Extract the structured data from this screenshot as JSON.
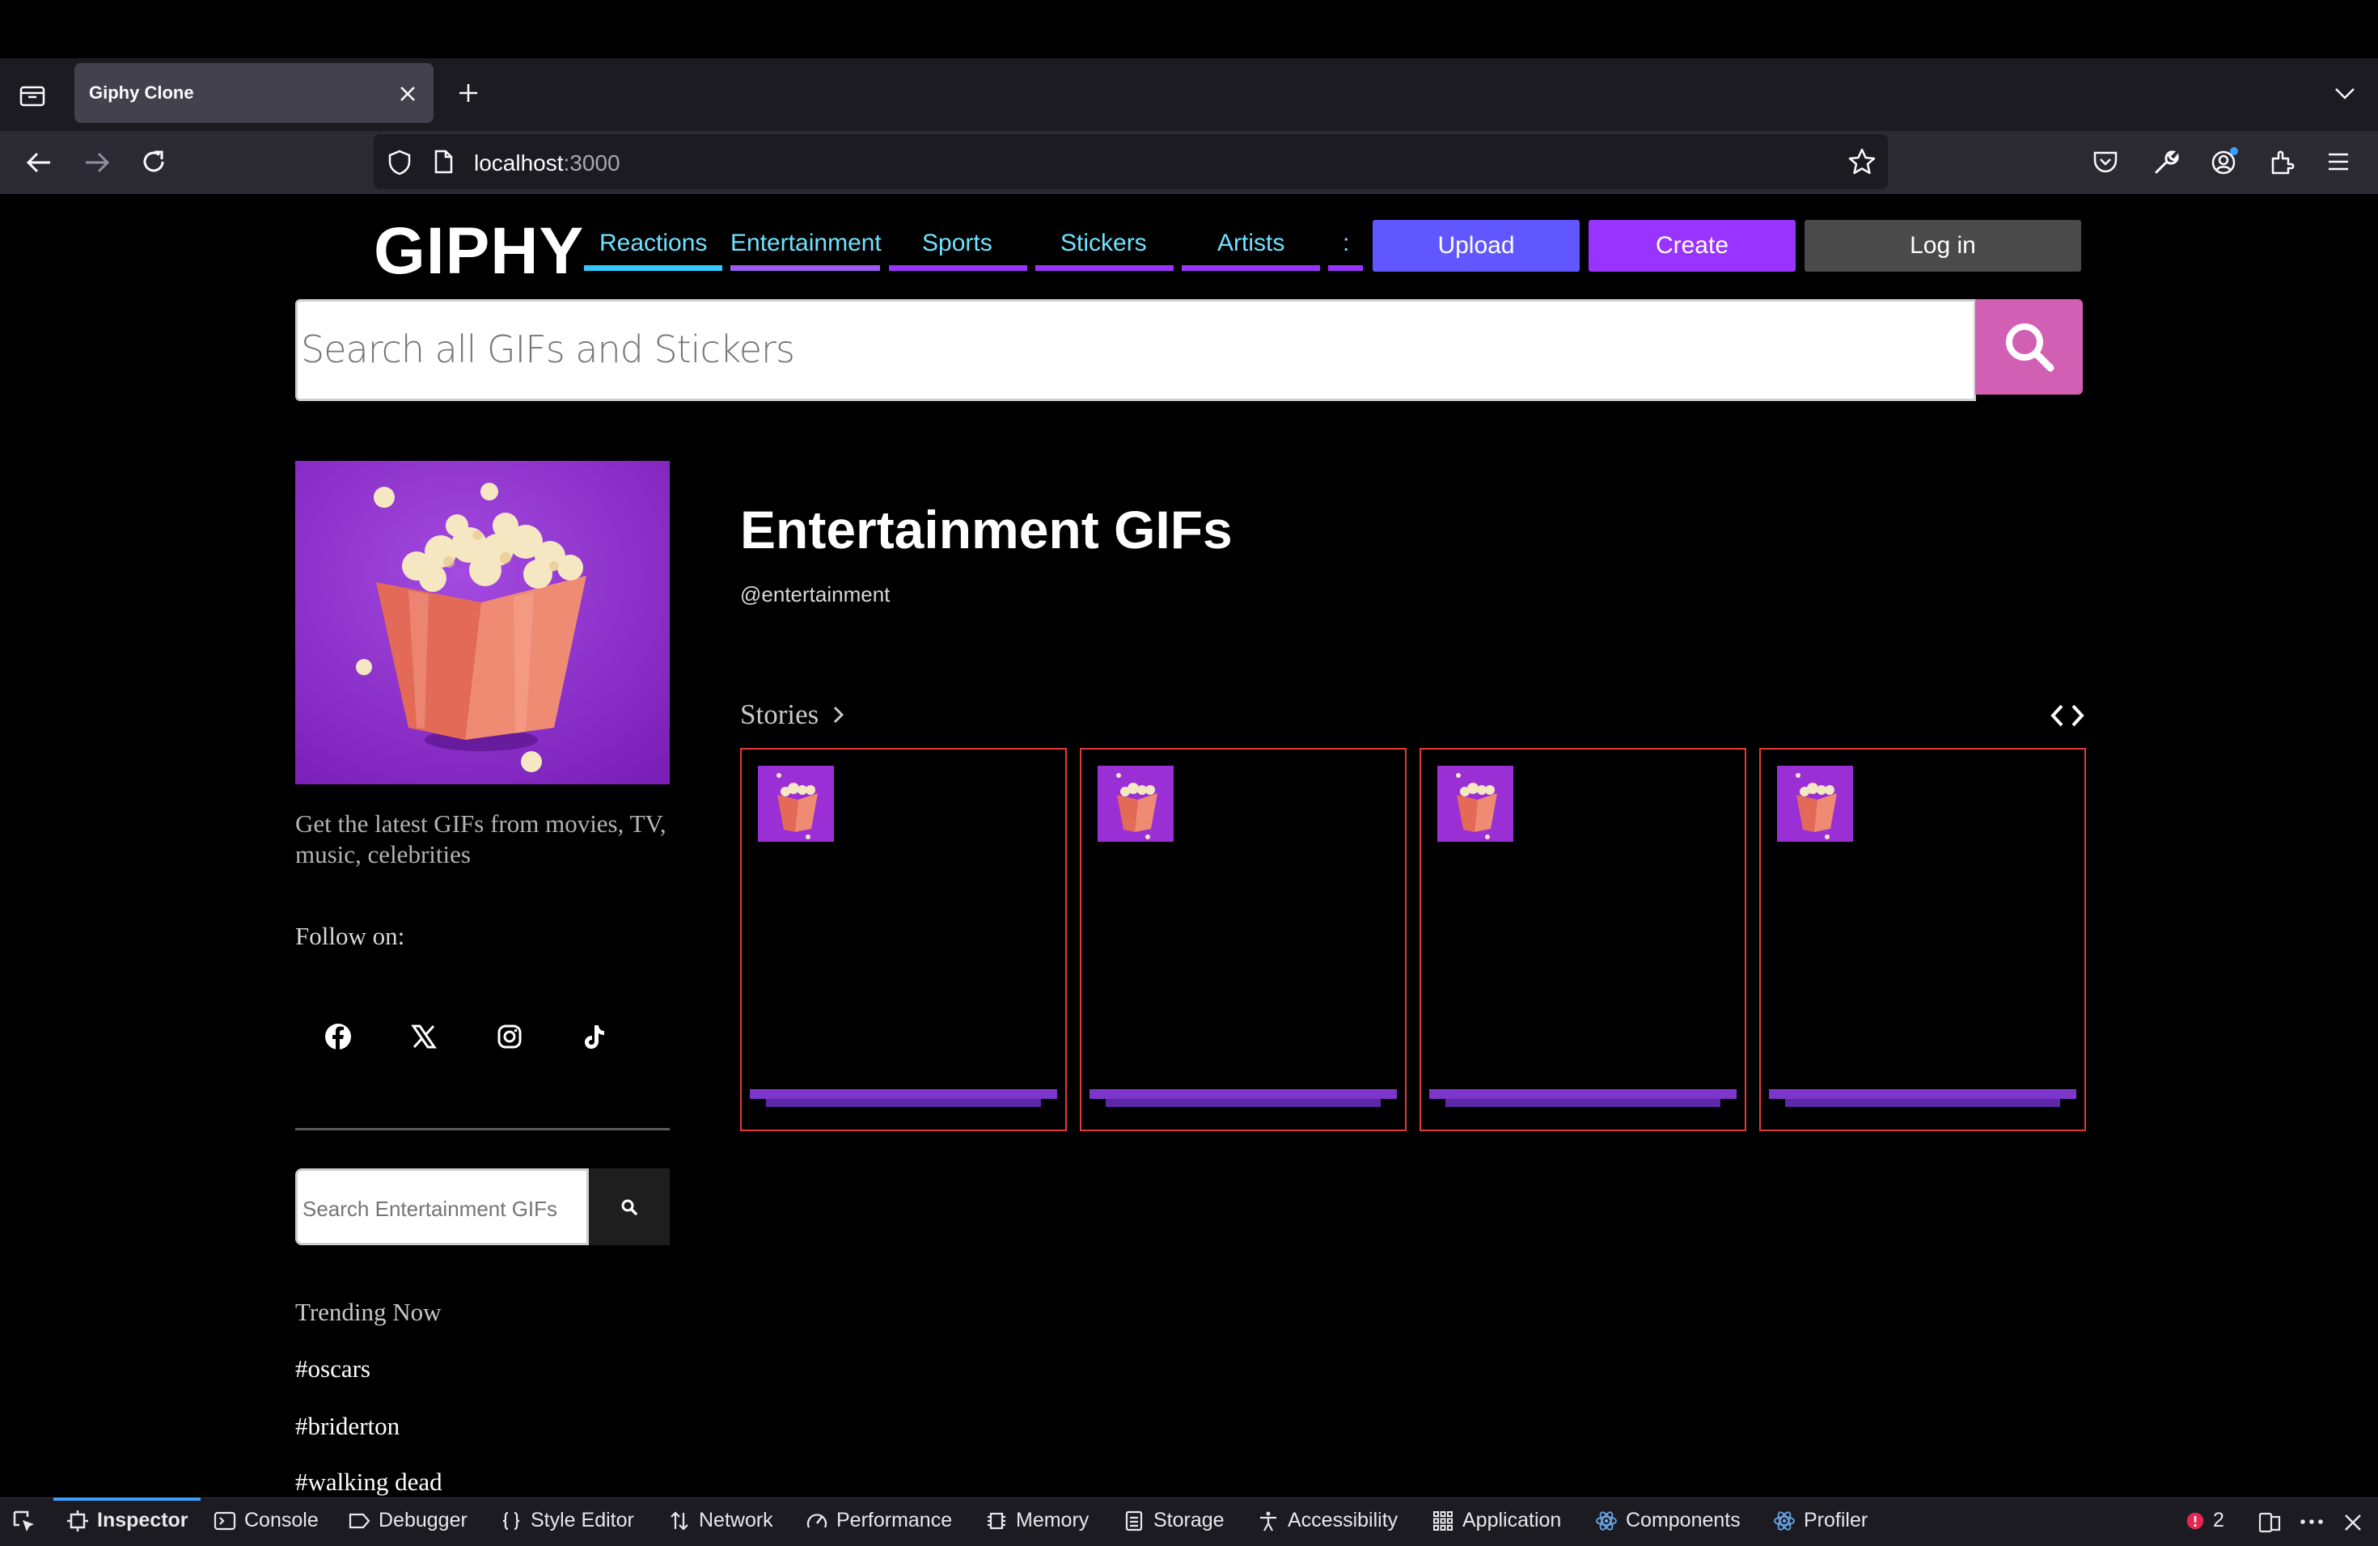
{
  "browser": {
    "tab_title": "Giphy Clone",
    "url_host": "localhost",
    "url_port": ":3000"
  },
  "header": {
    "logo": "GIPHY",
    "nav": [
      {
        "label": "Reactions",
        "color": "#35c7ff"
      },
      {
        "label": "Entertainment",
        "color": "#9b5cf5"
      },
      {
        "label": "Sports",
        "color": "#9933ff"
      },
      {
        "label": "Stickers",
        "color": "#9933ff"
      },
      {
        "label": "Artists",
        "color": "#9933ff"
      },
      {
        "label": ":",
        "color": "#9933ff"
      }
    ],
    "upload_label": "Upload",
    "create_label": "Create",
    "login_label": "Log in",
    "colors": {
      "upload": "#6157ff",
      "create": "#9933ff",
      "login": "#4a4a4a"
    }
  },
  "search": {
    "placeholder": "Search all GIFs and Stickers",
    "button_icon": "search-icon",
    "button_color": "#d15fb4"
  },
  "sidebar": {
    "description": "Get the latest GIFs from movies, TV, music, celebrities",
    "follow_label": "Follow on:",
    "social": [
      "facebook-icon",
      "x-icon",
      "instagram-icon",
      "tiktok-icon"
    ],
    "search_placeholder": "Search Entertainment GIFs",
    "trending_heading": "Trending Now",
    "trending": [
      "#oscars",
      "#briderton",
      "#walking dead"
    ]
  },
  "main": {
    "title": "Entertainment GIFs",
    "handle": "@entertainment",
    "stories_label": "Stories",
    "story_count": 4
  },
  "devtools": {
    "tabs": [
      "Inspector",
      "Console",
      "Debugger",
      "Style Editor",
      "Network",
      "Performance",
      "Memory",
      "Storage",
      "Accessibility",
      "Application",
      "Components",
      "Profiler"
    ],
    "error_count": "2"
  }
}
